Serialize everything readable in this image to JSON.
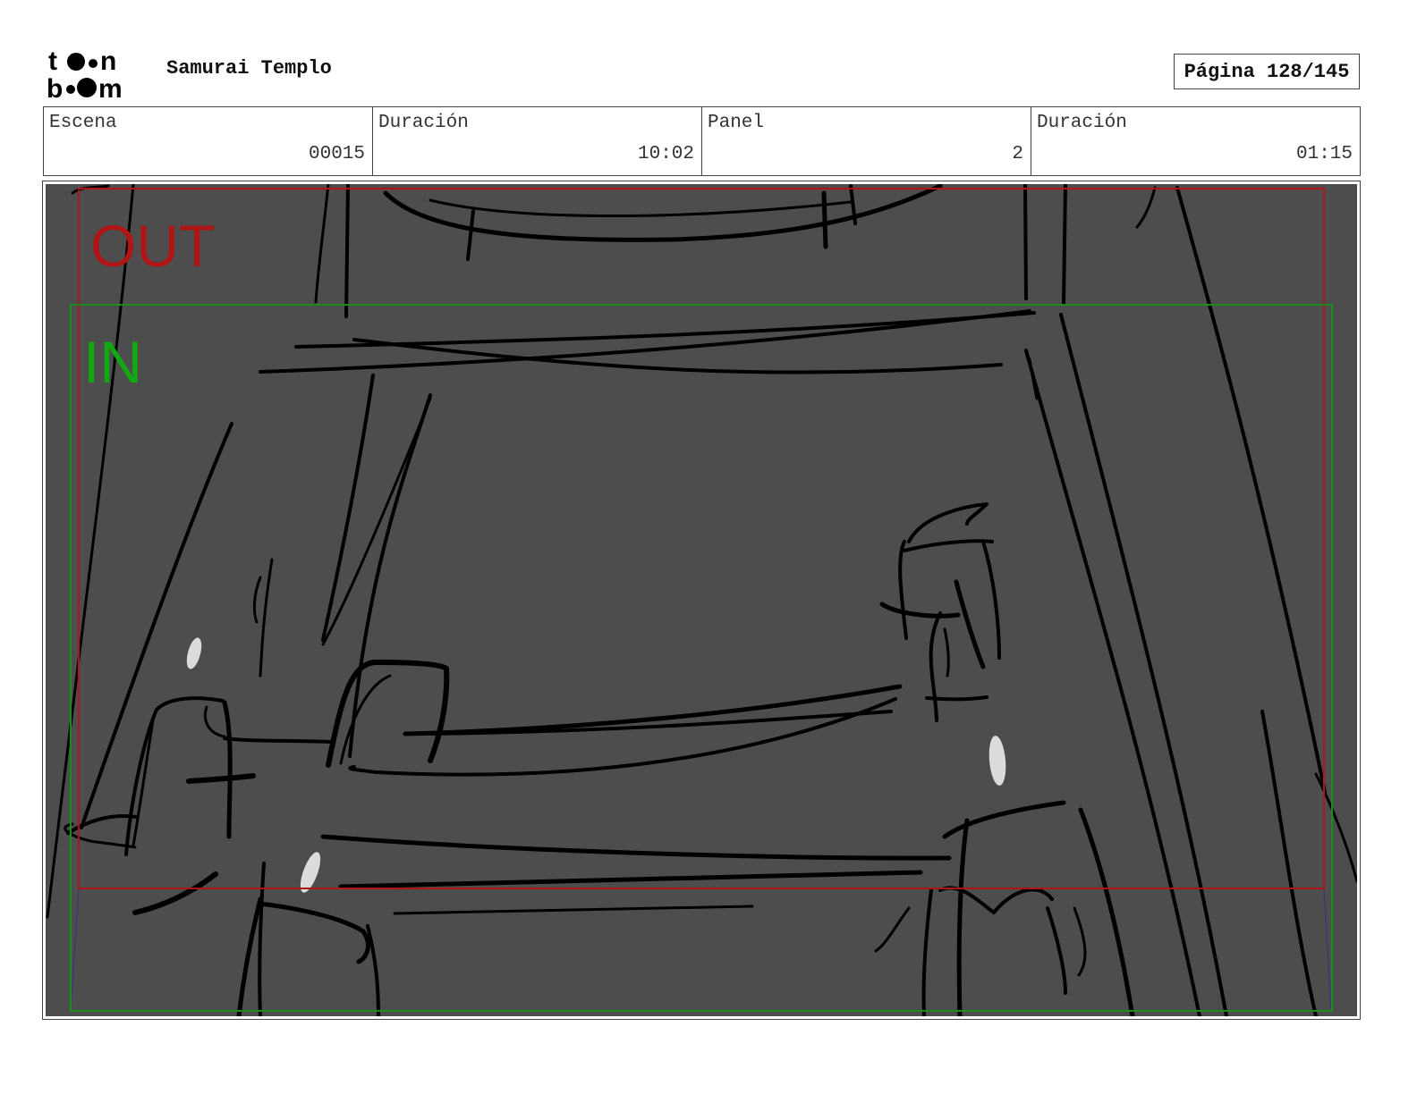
{
  "header": {
    "logo_text": "toon boom",
    "project_title": "Samurai Templo",
    "page_label": "Página 128/145"
  },
  "info": [
    {
      "label": "Escena",
      "value": "00015"
    },
    {
      "label": "Duración",
      "value": "10:02"
    },
    {
      "label": "Panel",
      "value": "2"
    },
    {
      "label": "Duración",
      "value": "01:15"
    }
  ],
  "panel": {
    "out_label": "OUT",
    "in_label": "IN",
    "colors": {
      "background": "#4d4d4d",
      "out_frame": "#b01515",
      "in_frame": "#1a8c1a",
      "sketch": "#000000",
      "highlight": "#dcdcdc"
    }
  }
}
